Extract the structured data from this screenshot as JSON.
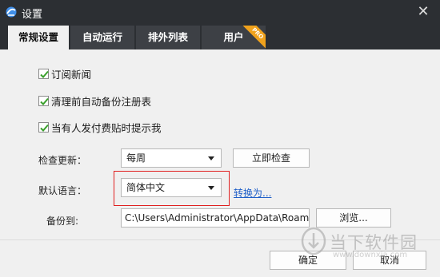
{
  "window": {
    "title": "设置",
    "close_glyph": "✕"
  },
  "tabs": [
    {
      "label": "常规设置",
      "active": true
    },
    {
      "label": "自动运行",
      "active": false
    },
    {
      "label": "排外列表",
      "active": false
    },
    {
      "label": "用户",
      "active": false,
      "badge": "PRO"
    }
  ],
  "options": [
    {
      "label": "订阅新闻",
      "checked": true
    },
    {
      "label": "清理前自动备份注册表",
      "checked": true
    },
    {
      "label": "当有人发付费贴时提示我",
      "checked": true
    }
  ],
  "update": {
    "label": "检查更新：",
    "value": "每周",
    "check_now": "立即检查"
  },
  "language": {
    "label": "默认语言：",
    "value": "简体中文",
    "convert_link": "转换为..."
  },
  "backup": {
    "label": "备份到:",
    "path": "C:\\Users\\Administrator\\AppData\\Roami...",
    "browse": "浏览..."
  },
  "footer": {
    "ok": "确定",
    "cancel": "取消"
  },
  "watermark": {
    "text": "当下软件园",
    "url": "www.downxia.com"
  },
  "colors": {
    "titlebar": "#2c2f33",
    "link": "#1f5fc8",
    "highlight": "#e02020",
    "check": "#3aa02c"
  }
}
